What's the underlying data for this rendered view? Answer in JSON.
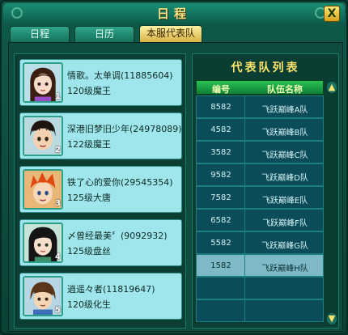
{
  "window": {
    "title": "日程",
    "close_label": "X"
  },
  "tabs": [
    {
      "label": "日程",
      "active": false
    },
    {
      "label": "日历",
      "active": false
    },
    {
      "label": "本服代表队",
      "active": true
    }
  ],
  "members": [
    {
      "name": "情歌。太单调",
      "id": "(11885604)",
      "level": "120级魔王",
      "rank": "1"
    },
    {
      "name": "深港旧梦旧少年",
      "id": "(24978089)",
      "level": "122级魔王",
      "rank": "2"
    },
    {
      "name": "铁了心的爱你",
      "id": "(29545354)",
      "level": "125级大唐",
      "rank": "3"
    },
    {
      "name": "〆曾经最美〞",
      "id": "(9092932)",
      "level": "125级盘丝",
      "rank": "4"
    },
    {
      "name": "逍遥々者",
      "id": "(11819647)",
      "level": "120级化生",
      "rank": "5"
    }
  ],
  "roster": {
    "title": "代表队列表",
    "col_id": "编号",
    "col_name": "队伍名称",
    "rows": [
      {
        "id": "8582",
        "name": "飞跃巅峰A队",
        "selected": false
      },
      {
        "id": "4582",
        "name": "飞跃巅峰B队",
        "selected": false
      },
      {
        "id": "3582",
        "name": "飞跃巅峰C队",
        "selected": false
      },
      {
        "id": "9582",
        "name": "飞跃巅峰D队",
        "selected": false
      },
      {
        "id": "7582",
        "name": "飞跃巅峰E队",
        "selected": false
      },
      {
        "id": "6582",
        "name": "飞跃巅峰F队",
        "selected": false
      },
      {
        "id": "5582",
        "name": "飞跃巅峰G队",
        "selected": false
      },
      {
        "id": "1582",
        "name": "飞跃巅峰H队",
        "selected": true
      }
    ],
    "scroll_up_icon": "scroll-up-icon",
    "scroll_down_icon": "scroll-down-icon"
  }
}
